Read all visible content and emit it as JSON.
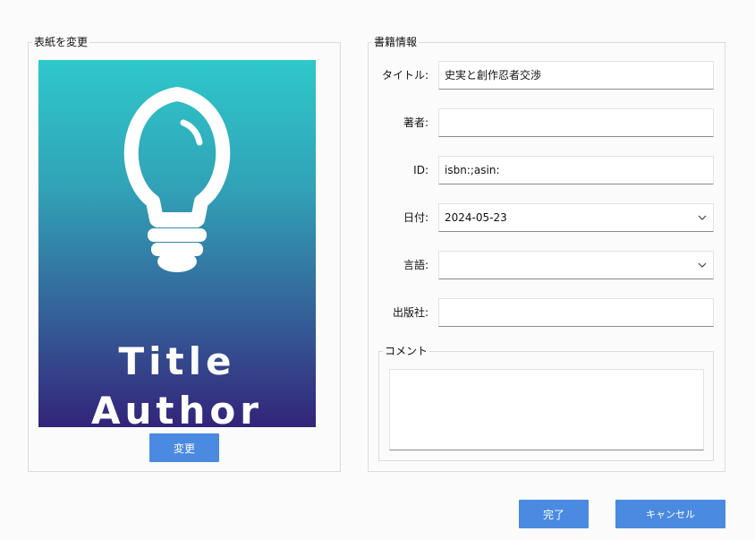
{
  "cover_section": {
    "legend": "表紙を変更",
    "cover_title": "Title",
    "cover_author": "Author",
    "change_button": "変更"
  },
  "info_section": {
    "legend": "書籍情報",
    "fields": {
      "title": {
        "label": "タイトル:",
        "value": "史実と創作忍者交渉"
      },
      "author": {
        "label": "著者:",
        "value": ""
      },
      "id": {
        "label": "ID:",
        "value": "isbn:;asin:"
      },
      "date": {
        "label": "日付:",
        "value": "2024-05-23"
      },
      "language": {
        "label": "言語:",
        "value": ""
      },
      "publisher": {
        "label": "出版社:",
        "value": ""
      }
    },
    "comment": {
      "legend": "コメント",
      "value": ""
    }
  },
  "footer": {
    "done_button": "完了",
    "cancel_button": "キャンセル"
  },
  "colors": {
    "accent": "#4a8ae0",
    "cover_gradient_top": "#2ec8cb",
    "cover_gradient_bottom": "#33247a"
  },
  "icons": {
    "cover_icon": "lightbulb-icon",
    "dropdown_icon": "chevron-down-icon"
  }
}
